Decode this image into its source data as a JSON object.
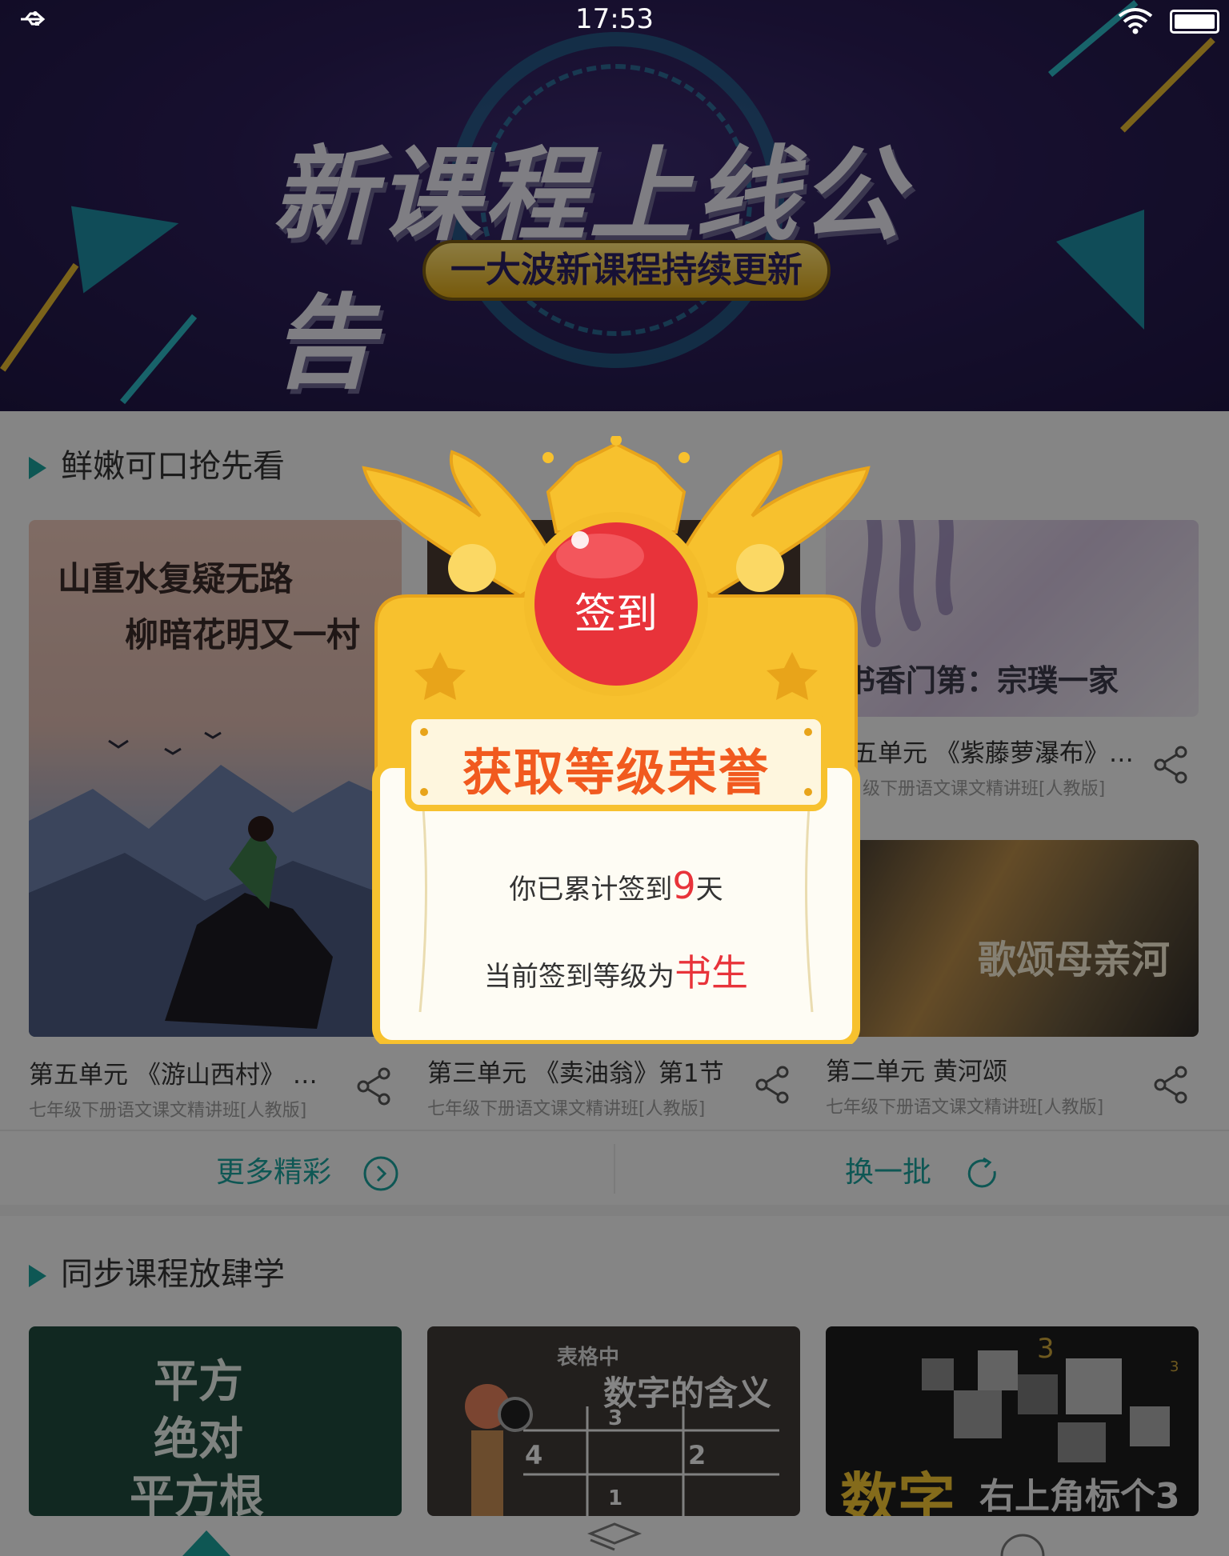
{
  "status_bar": {
    "time": "17:53"
  },
  "banner": {
    "title": "新课程上线公告",
    "subtitle": "一大波新课程持续更新"
  },
  "section1": {
    "title": "鲜嫩可口抢先看",
    "cards": [
      {
        "thumb_text_1": "山重水复疑无路",
        "thumb_text_2": "柳暗花明又一村",
        "title": "第五单元 《游山西村》 …",
        "subtitle": "七年级下册语文课文精讲班[人教版]"
      },
      {
        "title": "第三单元 《卖油翁》第1节",
        "subtitle": "七年级下册语文课文精讲班[人教版]"
      },
      {
        "thumb_text": "书香门第：宗璞一家",
        "title": "五单元 《紫藤萝瀑布》…",
        "subtitle": "级下册语文课文精讲班[人教版]"
      },
      {
        "thumb_text": "歌颂母亲河",
        "title": "第二单元 黄河颂",
        "subtitle": "七年级下册语文课文精讲班[人教版]"
      }
    ],
    "more_label": "更多精彩",
    "refresh_label": "换一批"
  },
  "section2": {
    "title": "同步课程放肆学",
    "cards": [
      {
        "lines": [
          "平方",
          "绝对",
          "平方根"
        ]
      },
      {
        "line_1": "表格中",
        "line_2": "数字的含义",
        "grid": [
          "3",
          "4",
          "2",
          "1"
        ]
      },
      {
        "line_1": "数字",
        "line_2": "右上角标个3",
        "mark_1": "3",
        "mark_2": "3"
      }
    ]
  },
  "modal": {
    "badge_label": "签到",
    "header_label": "获取等级荣誉",
    "line1_prefix": "你已累计签到",
    "line1_days": "9",
    "line1_suffix": "天",
    "line2_prefix": "当前签到等级为",
    "line2_level": "书生"
  },
  "colors": {
    "accent": "#1a9e9a",
    "highlight": "#e8333a",
    "gold": "#f7c12e",
    "header_text": "#f15a1f"
  }
}
